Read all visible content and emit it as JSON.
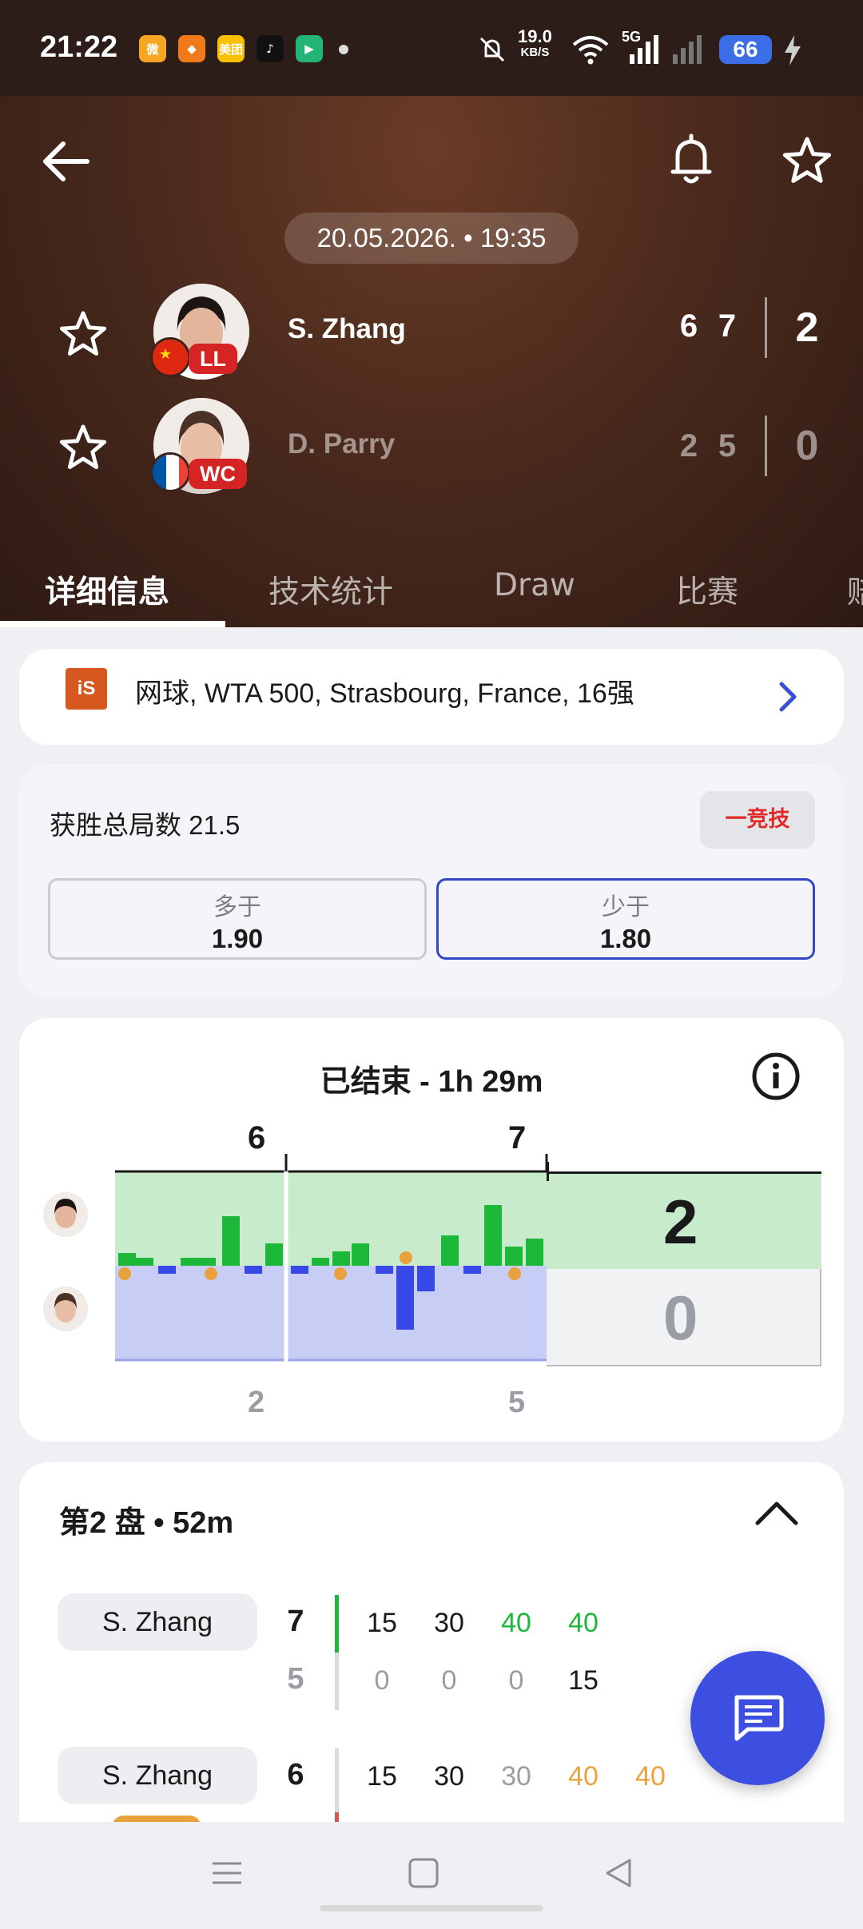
{
  "status_bar": {
    "time": "21:22",
    "apps": [
      {
        "icon": "weibo-icon",
        "label": "微",
        "color": "#f5a623"
      },
      {
        "icon": "app-orange-icon",
        "label": "◆",
        "color": "#f07a1a"
      },
      {
        "icon": "meituan-icon",
        "label": "美团",
        "color": "#f7c000"
      },
      {
        "icon": "tiktok-icon",
        "label": "♪",
        "color": "#111111"
      },
      {
        "icon": "video-app-icon",
        "label": "▶",
        "color": "#22b573"
      }
    ],
    "speed_value": "19.0",
    "speed_unit": "KB/S",
    "network": "5G",
    "battery": "66"
  },
  "header": {
    "datetime": "20.05.2026. • 19:35",
    "players": [
      {
        "name": "S. Zhang",
        "badge": "LL",
        "flag": "china-flag",
        "sets": [
          "6",
          "7"
        ],
        "total": "2",
        "winner": true
      },
      {
        "name": "D. Parry",
        "badge": "WC",
        "flag": "france-flag",
        "sets": [
          "2",
          "5"
        ],
        "total": "0",
        "winner": false
      }
    ],
    "tabs": [
      "详细信息",
      "技术统计",
      "Draw",
      "比赛",
      "赔"
    ]
  },
  "tournament": {
    "icon_text": "iS",
    "text": "网球, WTA 500, Strasbourg, France, 16强"
  },
  "betting": {
    "title": "获胜总局数 21.5",
    "sponsor": "一竞技",
    "options": [
      {
        "label": "多于",
        "value": "1.90",
        "selected": false
      },
      {
        "label": "少于",
        "value": "1.80",
        "selected": true
      }
    ]
  },
  "timeline": {
    "title": "已结束 - 1h 29m",
    "set1_label_top": "6",
    "set1_label_bottom": "2",
    "set2_label_top": "7",
    "set2_label_bottom": "5",
    "final_top": "2",
    "final_bottom": "0",
    "colors": {
      "p1": "#1db83a",
      "p1_bg": "#c8ebcc",
      "p2": "#3748e6",
      "p2_bg": "#c8cdf6",
      "ball": "#e9a23b"
    }
  },
  "set_detail": {
    "title": "第2 盘 • 52m",
    "games": [
      {
        "server": "S. Zhang",
        "top_score": "7",
        "bottom_score": "5",
        "bar_color": "#1db83a",
        "top_points": [
          {
            "v": "15",
            "c": "#1a1a1a"
          },
          {
            "v": "30",
            "c": "#1a1a1a"
          },
          {
            "v": "40",
            "c": "#1db83a"
          },
          {
            "v": "40",
            "c": "#1db83a"
          }
        ],
        "bottom_points": [
          {
            "v": "0",
            "c": "#9a9da3"
          },
          {
            "v": "0",
            "c": "#9a9da3"
          },
          {
            "v": "0",
            "c": "#9a9da3"
          },
          {
            "v": "15",
            "c": "#1a1a1a"
          }
        ]
      },
      {
        "server": "S. Zhang",
        "top_score": "6",
        "bar_color": "#d9534f",
        "top_points": [
          {
            "v": "15",
            "c": "#1a1a1a"
          },
          {
            "v": "30",
            "c": "#1a1a1a"
          },
          {
            "v": "30",
            "c": "#9a9da3"
          },
          {
            "v": "40",
            "c": "#e9a23b"
          },
          {
            "v": "40",
            "c": "#e9a23b"
          }
        ]
      }
    ]
  }
}
